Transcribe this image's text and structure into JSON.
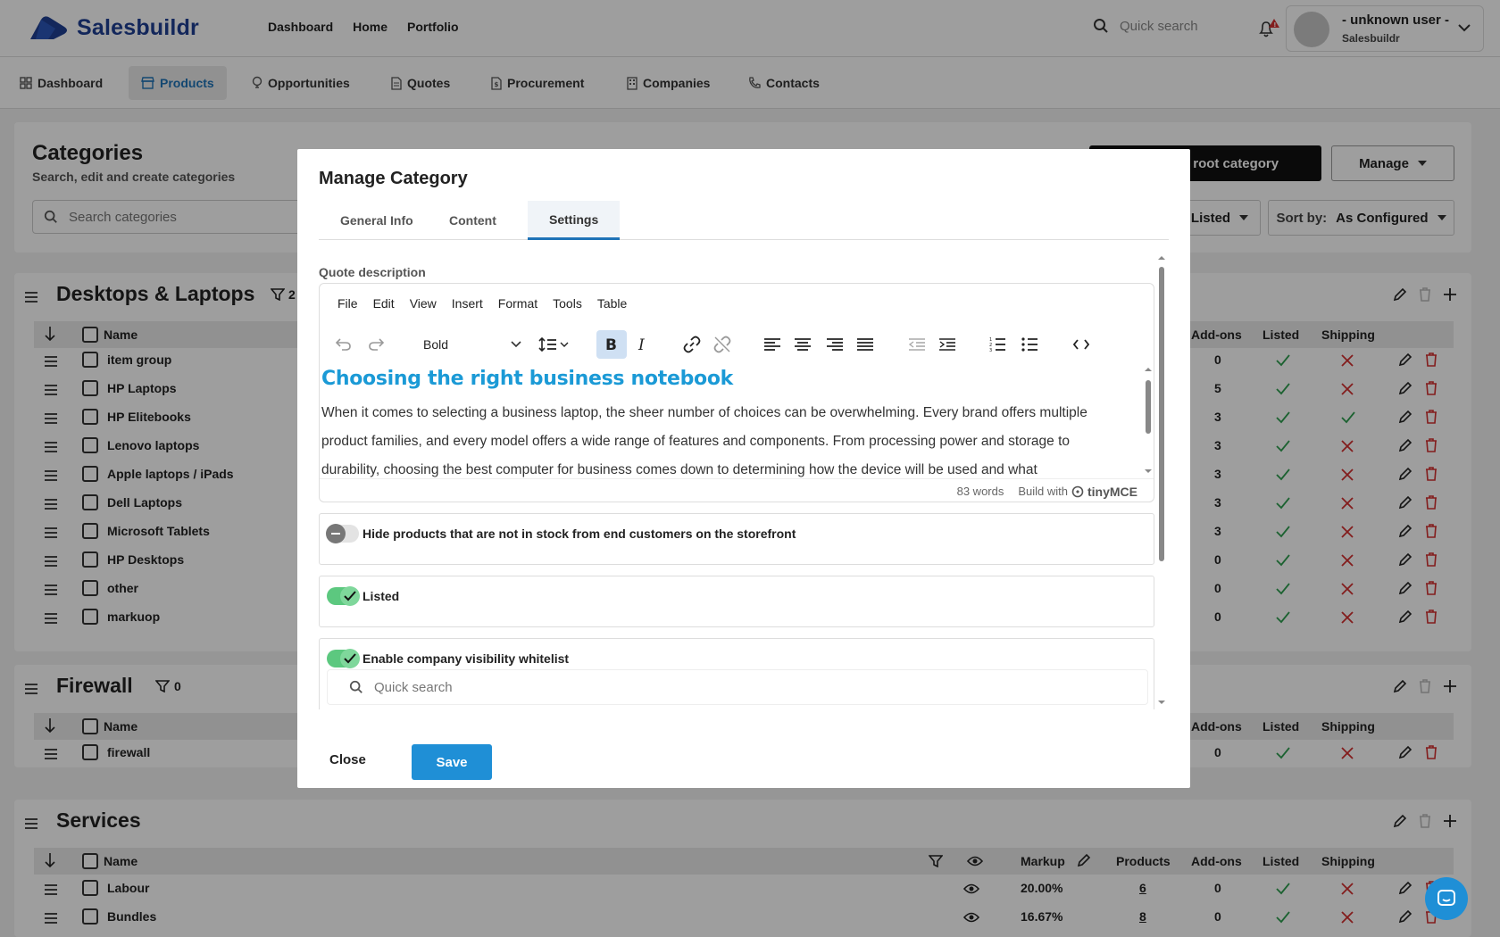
{
  "app": {
    "name": "Salesbuildr"
  },
  "topnav": [
    "Dashboard",
    "Home",
    "Portfolio"
  ],
  "quick_search_placeholder": "Quick search",
  "user": {
    "name": "- unknown user -",
    "company": "Salesbuildr"
  },
  "secnav": [
    {
      "label": "Dashboard",
      "icon": "dashboard-icon"
    },
    {
      "label": "Products",
      "icon": "store-icon",
      "active": true
    },
    {
      "label": "Opportunities",
      "icon": "lightbulb-icon"
    },
    {
      "label": "Quotes",
      "icon": "document-icon"
    },
    {
      "label": "Procurement",
      "icon": "invoice-icon"
    },
    {
      "label": "Companies",
      "icon": "building-icon"
    },
    {
      "label": "Contacts",
      "icon": "phone-icon"
    }
  ],
  "categories": {
    "title": "Categories",
    "subtitle": "Search, edit and create categories",
    "search_placeholder": "Search categories",
    "new_root_button": "New root category",
    "new_root_visible": "iew root category",
    "manage_button": "Manage",
    "listed_filter": "Listed",
    "sort_label": "Sort by:",
    "sort_value": "As Configured"
  },
  "table_headers": {
    "name": "Name",
    "markup": "Markup",
    "products": "Products",
    "addons": "Add-ons",
    "listed": "Listed",
    "shipping": "Shipping"
  },
  "sections": [
    {
      "name": "Desktops & Laptops",
      "filter_count": "2",
      "rows": [
        {
          "name": "item group",
          "addons": "0",
          "listed": true,
          "shipping": false
        },
        {
          "name": "HP Laptops",
          "addons": "5",
          "listed": true,
          "shipping": false
        },
        {
          "name": "HP Elitebooks",
          "addons": "3",
          "listed": true,
          "shipping": true
        },
        {
          "name": "Lenovo laptops",
          "addons": "3",
          "listed": true,
          "shipping": false
        },
        {
          "name": "Apple laptops / iPads",
          "addons": "3",
          "listed": true,
          "shipping": false
        },
        {
          "name": "Dell Laptops",
          "addons": "3",
          "listed": true,
          "shipping": false
        },
        {
          "name": "Microsoft Tablets",
          "addons": "3",
          "listed": true,
          "shipping": false
        },
        {
          "name": "HP Desktops",
          "addons": "0",
          "listed": true,
          "shipping": false
        },
        {
          "name": "other",
          "addons": "0",
          "listed": true,
          "shipping": false
        },
        {
          "name": "markuop",
          "addons": "0",
          "listed": true,
          "shipping": false
        }
      ]
    },
    {
      "name": "Firewall",
      "filter_count": "0",
      "rows": [
        {
          "name": "firewall",
          "addons": "0",
          "listed": true,
          "shipping": false
        }
      ]
    },
    {
      "name": "Services",
      "rows": [
        {
          "name": "Labour",
          "markup": "20.00%",
          "products": "6",
          "addons": "0",
          "listed": true,
          "shipping": false
        },
        {
          "name": "Bundles",
          "markup": "16.67%",
          "products": "8",
          "addons": "0",
          "listed": true,
          "shipping": false
        }
      ]
    }
  ],
  "modal": {
    "title": "Manage Category",
    "tabs": [
      "General Info",
      "Content",
      "Settings"
    ],
    "active_tab": "Settings",
    "quote_description_label": "Quote description",
    "editor": {
      "menu": [
        "File",
        "Edit",
        "View",
        "Insert",
        "Format",
        "Tools",
        "Table"
      ],
      "block_format": "Bold",
      "heading": "Choosing the right business notebook",
      "paragraph": "When it comes to selecting a business laptop, the sheer number of choices can be overwhelming. Every brand offers multiple product families, and every model offers a wide range of features and components. From processing power and storage to durability, choosing the best computer for business comes down to determining how the device will be used and what",
      "word_count": "83 words",
      "branding": "Build with",
      "branding_name": "tinyMCE"
    },
    "options": [
      {
        "label": "Hide products that are not in stock from end customers on the storefront",
        "enabled": false
      },
      {
        "label": "Listed",
        "enabled": true
      },
      {
        "label": "Enable company visibility whitelist",
        "enabled": true
      }
    ],
    "whitelist_search_placeholder": "Quick search",
    "close_button": "Close",
    "save_button": "Save"
  },
  "colors": {
    "brand": "#1f3f93",
    "accent": "#1f8fd6",
    "heading": "#1b9ad6",
    "check": "#2e9e4f",
    "cross": "#d32f2f",
    "toggle_on": "#5cc87f"
  }
}
